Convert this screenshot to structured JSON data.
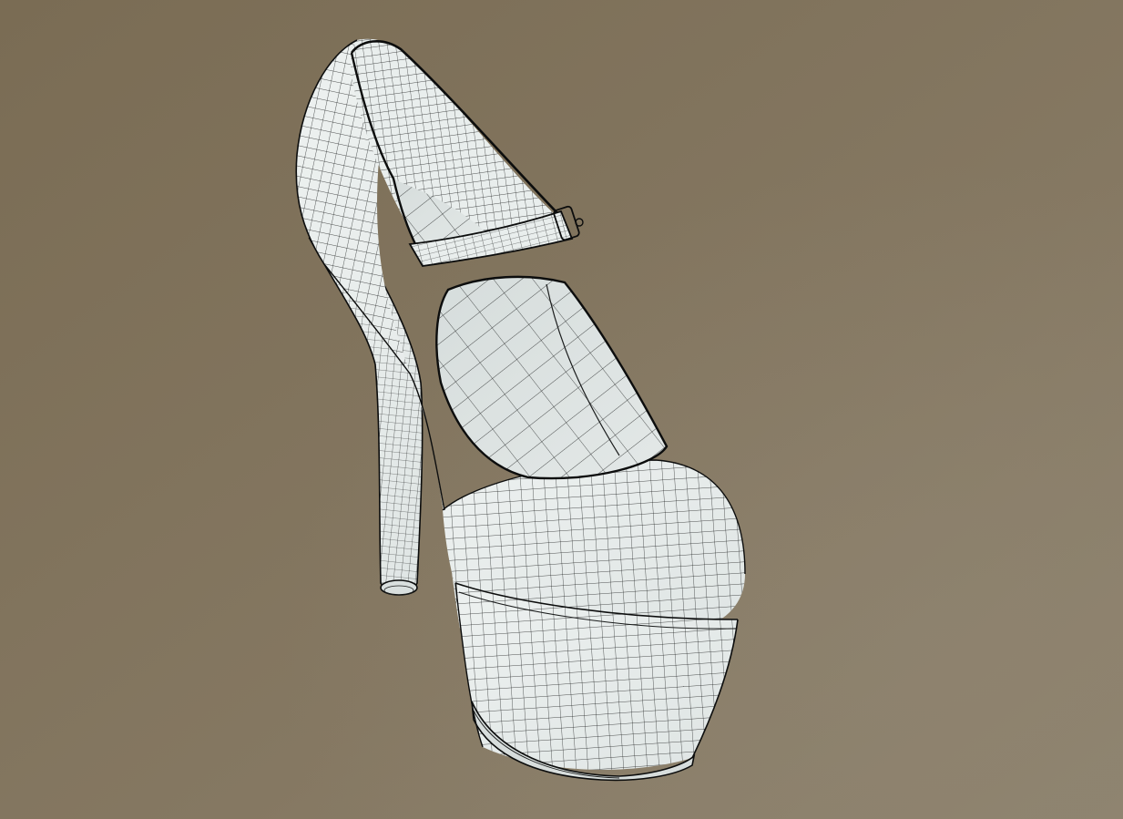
{
  "viewport": {
    "background_colors": [
      "#7a6c54",
      "#857862",
      "#8f8470"
    ],
    "lighting": "top-left"
  },
  "model": {
    "object": "mary-jane-platform-high-heel-shoe",
    "render_mode": "wireframe-on-shaded",
    "surface_color": "#e6ebea",
    "shadow_color": "#c9d0cf",
    "wire_color": "#1b1d1d",
    "outline_color": "#0c0d0d",
    "parts": [
      "heel-counter",
      "ankle-strap",
      "buckle",
      "vamp",
      "insole",
      "platform",
      "sole",
      "stiletto-heel"
    ]
  }
}
